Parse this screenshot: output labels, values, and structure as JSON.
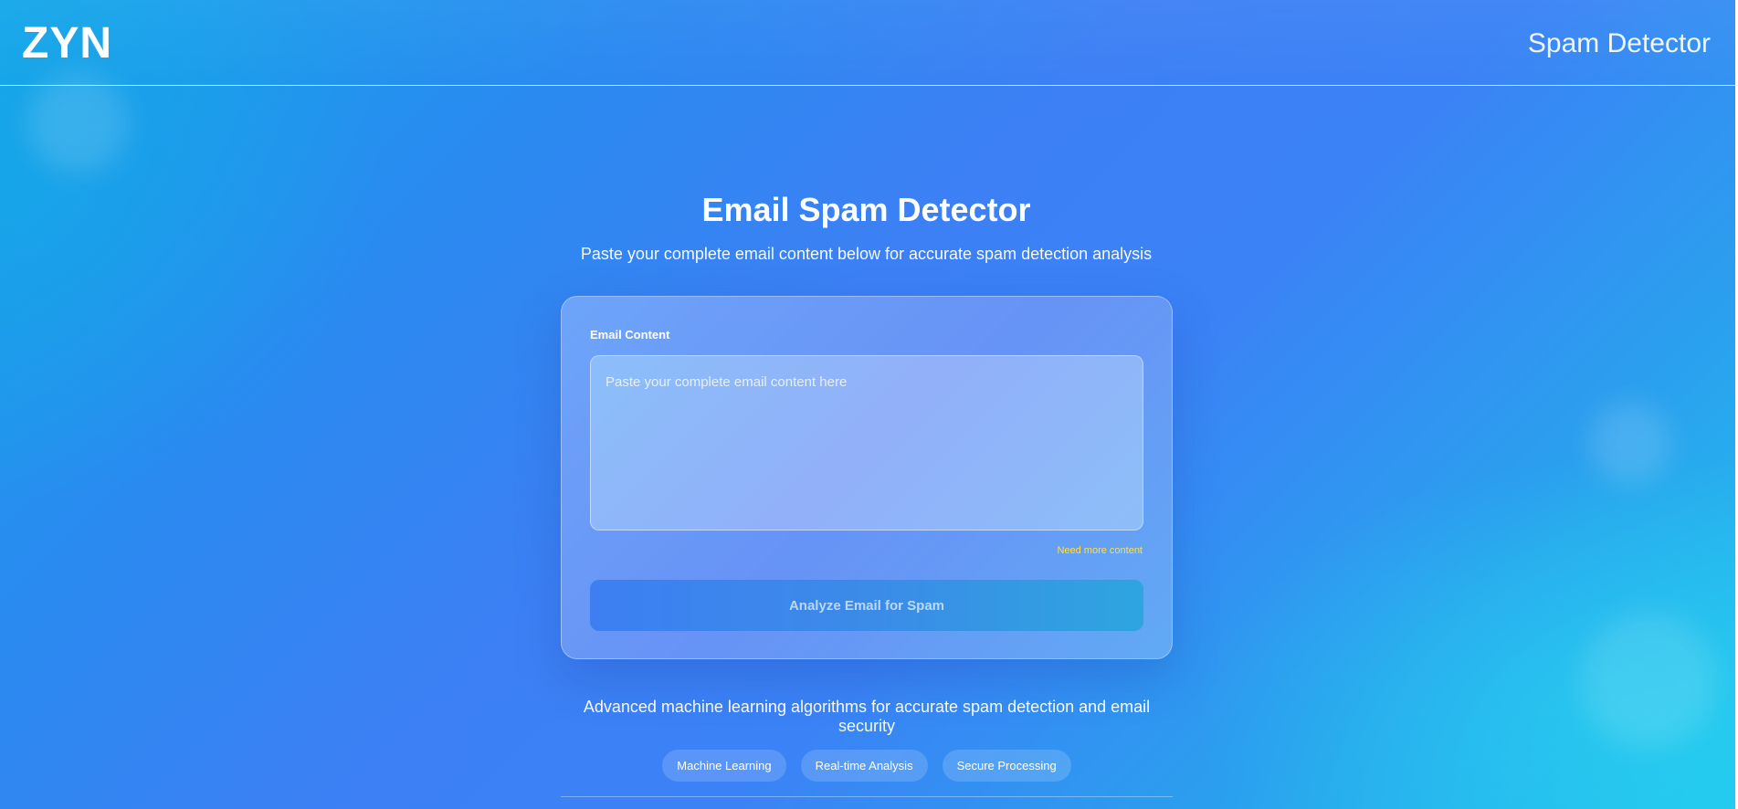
{
  "header": {
    "logo": "ZYN",
    "product_name": "Spam Detector"
  },
  "hero": {
    "title": "Email Spam Detector",
    "subtitle": "Paste your complete email content below for accurate spam detection analysis"
  },
  "form": {
    "field_label": "Email Content",
    "textarea_value": "",
    "textarea_placeholder": "Paste your complete email content here",
    "validation_message": "Need more content",
    "submit_label": "Analyze Email for Spam"
  },
  "footer": {
    "tagline": "Advanced machine learning algorithms for accurate spam detection and email security",
    "features": [
      "Machine Learning",
      "Real-time Analysis",
      "Secure Processing"
    ]
  },
  "colors": {
    "validation_text": "#fde047",
    "background_accent": "#3b82f6"
  }
}
